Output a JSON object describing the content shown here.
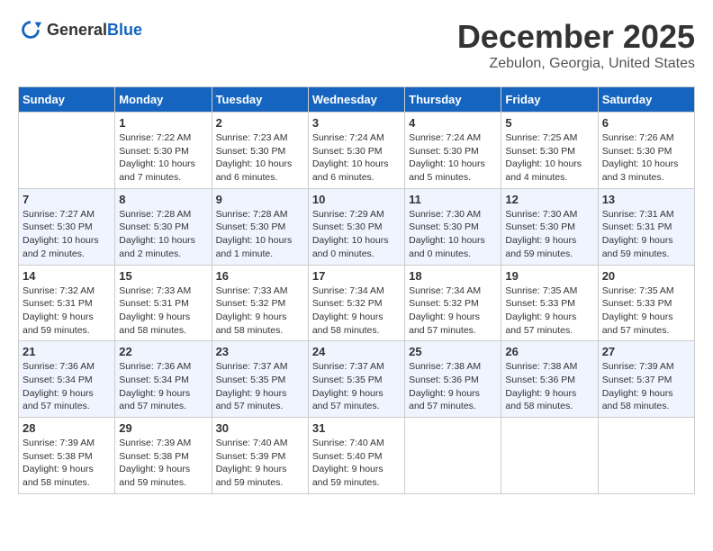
{
  "header": {
    "logo_general": "General",
    "logo_blue": "Blue",
    "month": "December 2025",
    "location": "Zebulon, Georgia, United States"
  },
  "weekdays": [
    "Sunday",
    "Monday",
    "Tuesday",
    "Wednesday",
    "Thursday",
    "Friday",
    "Saturday"
  ],
  "weeks": [
    [
      {
        "day": "",
        "text": ""
      },
      {
        "day": "1",
        "text": "Sunrise: 7:22 AM\nSunset: 5:30 PM\nDaylight: 10 hours\nand 7 minutes."
      },
      {
        "day": "2",
        "text": "Sunrise: 7:23 AM\nSunset: 5:30 PM\nDaylight: 10 hours\nand 6 minutes."
      },
      {
        "day": "3",
        "text": "Sunrise: 7:24 AM\nSunset: 5:30 PM\nDaylight: 10 hours\nand 6 minutes."
      },
      {
        "day": "4",
        "text": "Sunrise: 7:24 AM\nSunset: 5:30 PM\nDaylight: 10 hours\nand 5 minutes."
      },
      {
        "day": "5",
        "text": "Sunrise: 7:25 AM\nSunset: 5:30 PM\nDaylight: 10 hours\nand 4 minutes."
      },
      {
        "day": "6",
        "text": "Sunrise: 7:26 AM\nSunset: 5:30 PM\nDaylight: 10 hours\nand 3 minutes."
      }
    ],
    [
      {
        "day": "7",
        "text": "Sunrise: 7:27 AM\nSunset: 5:30 PM\nDaylight: 10 hours\nand 2 minutes."
      },
      {
        "day": "8",
        "text": "Sunrise: 7:28 AM\nSunset: 5:30 PM\nDaylight: 10 hours\nand 2 minutes."
      },
      {
        "day": "9",
        "text": "Sunrise: 7:28 AM\nSunset: 5:30 PM\nDaylight: 10 hours\nand 1 minute."
      },
      {
        "day": "10",
        "text": "Sunrise: 7:29 AM\nSunset: 5:30 PM\nDaylight: 10 hours\nand 0 minutes."
      },
      {
        "day": "11",
        "text": "Sunrise: 7:30 AM\nSunset: 5:30 PM\nDaylight: 10 hours\nand 0 minutes."
      },
      {
        "day": "12",
        "text": "Sunrise: 7:30 AM\nSunset: 5:30 PM\nDaylight: 9 hours\nand 59 minutes."
      },
      {
        "day": "13",
        "text": "Sunrise: 7:31 AM\nSunset: 5:31 PM\nDaylight: 9 hours\nand 59 minutes."
      }
    ],
    [
      {
        "day": "14",
        "text": "Sunrise: 7:32 AM\nSunset: 5:31 PM\nDaylight: 9 hours\nand 59 minutes."
      },
      {
        "day": "15",
        "text": "Sunrise: 7:33 AM\nSunset: 5:31 PM\nDaylight: 9 hours\nand 58 minutes."
      },
      {
        "day": "16",
        "text": "Sunrise: 7:33 AM\nSunset: 5:32 PM\nDaylight: 9 hours\nand 58 minutes."
      },
      {
        "day": "17",
        "text": "Sunrise: 7:34 AM\nSunset: 5:32 PM\nDaylight: 9 hours\nand 58 minutes."
      },
      {
        "day": "18",
        "text": "Sunrise: 7:34 AM\nSunset: 5:32 PM\nDaylight: 9 hours\nand 57 minutes."
      },
      {
        "day": "19",
        "text": "Sunrise: 7:35 AM\nSunset: 5:33 PM\nDaylight: 9 hours\nand 57 minutes."
      },
      {
        "day": "20",
        "text": "Sunrise: 7:35 AM\nSunset: 5:33 PM\nDaylight: 9 hours\nand 57 minutes."
      }
    ],
    [
      {
        "day": "21",
        "text": "Sunrise: 7:36 AM\nSunset: 5:34 PM\nDaylight: 9 hours\nand 57 minutes."
      },
      {
        "day": "22",
        "text": "Sunrise: 7:36 AM\nSunset: 5:34 PM\nDaylight: 9 hours\nand 57 minutes."
      },
      {
        "day": "23",
        "text": "Sunrise: 7:37 AM\nSunset: 5:35 PM\nDaylight: 9 hours\nand 57 minutes."
      },
      {
        "day": "24",
        "text": "Sunrise: 7:37 AM\nSunset: 5:35 PM\nDaylight: 9 hours\nand 57 minutes."
      },
      {
        "day": "25",
        "text": "Sunrise: 7:38 AM\nSunset: 5:36 PM\nDaylight: 9 hours\nand 57 minutes."
      },
      {
        "day": "26",
        "text": "Sunrise: 7:38 AM\nSunset: 5:36 PM\nDaylight: 9 hours\nand 58 minutes."
      },
      {
        "day": "27",
        "text": "Sunrise: 7:39 AM\nSunset: 5:37 PM\nDaylight: 9 hours\nand 58 minutes."
      }
    ],
    [
      {
        "day": "28",
        "text": "Sunrise: 7:39 AM\nSunset: 5:38 PM\nDaylight: 9 hours\nand 58 minutes."
      },
      {
        "day": "29",
        "text": "Sunrise: 7:39 AM\nSunset: 5:38 PM\nDaylight: 9 hours\nand 59 minutes."
      },
      {
        "day": "30",
        "text": "Sunrise: 7:40 AM\nSunset: 5:39 PM\nDaylight: 9 hours\nand 59 minutes."
      },
      {
        "day": "31",
        "text": "Sunrise: 7:40 AM\nSunset: 5:40 PM\nDaylight: 9 hours\nand 59 minutes."
      },
      {
        "day": "",
        "text": ""
      },
      {
        "day": "",
        "text": ""
      },
      {
        "day": "",
        "text": ""
      }
    ]
  ]
}
